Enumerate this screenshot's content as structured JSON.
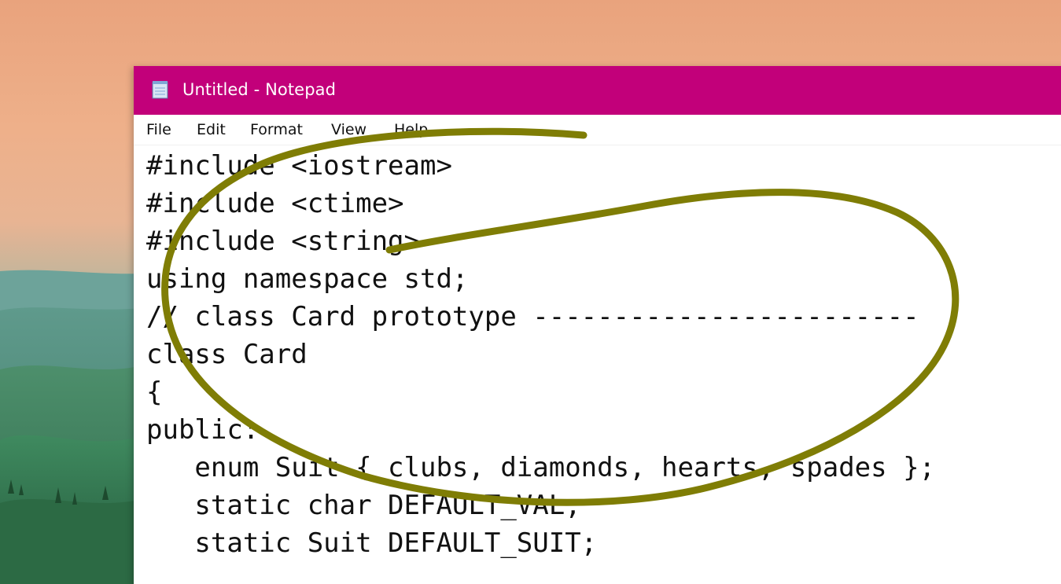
{
  "window": {
    "title": "Untitled - Notepad",
    "titlebar_color": "#c2007a",
    "app_icon": "notepad-icon"
  },
  "menu": {
    "items": [
      {
        "label": "File"
      },
      {
        "label": "Edit"
      },
      {
        "label": "Format"
      },
      {
        "label": "View"
      },
      {
        "label": "Help"
      }
    ]
  },
  "editor": {
    "lines": [
      "#include <iostream>",
      "#include <ctime>",
      "#include <string>",
      "using namespace std;",
      "// class Card prototype ------------------------",
      "class Card",
      "{",
      "public:",
      "   enum Suit { clubs, diamonds, hearts, spades };",
      "   static char DEFAULT_VAL;",
      "   static Suit DEFAULT_SUIT;"
    ]
  },
  "annotation": {
    "color": "#7f7d05",
    "shape": "hand-drawn-circle"
  }
}
